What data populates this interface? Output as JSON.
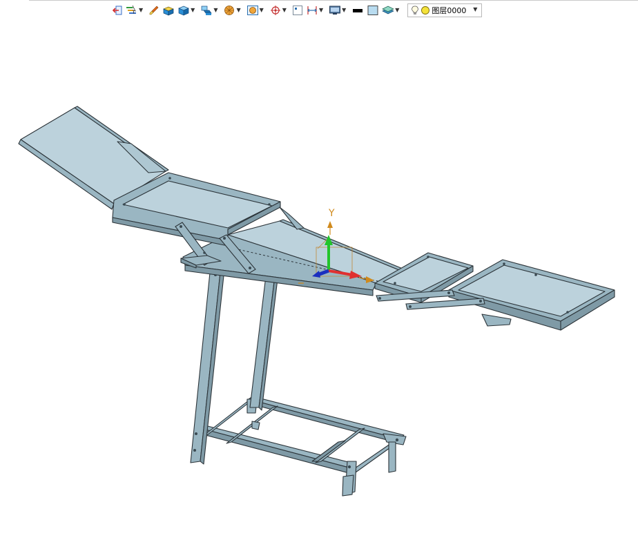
{
  "toolbar": {
    "layer_value": "图层0000",
    "items": [
      {
        "icon": "exit-sketch-icon"
      },
      {
        "icon": "selection-filter-icon",
        "dropdown": true
      },
      {
        "icon": "brush-icon"
      },
      {
        "icon": "solid-box-icon"
      },
      {
        "icon": "cube-icon",
        "dropdown": true
      },
      {
        "icon": "extrude-icon",
        "dropdown": true
      },
      {
        "icon": "sphere-render-icon",
        "dropdown": true
      },
      {
        "icon": "view-fit-icon",
        "dropdown": true
      },
      {
        "icon": "snap-target-icon",
        "dropdown": true
      },
      {
        "icon": "frame-icon"
      },
      {
        "icon": "dimension-icon",
        "dropdown": true
      },
      {
        "icon": "display-monitor-icon",
        "dropdown": true
      },
      {
        "icon": "line-color-icon"
      },
      {
        "icon": "fill-color-icon"
      },
      {
        "icon": "layer-stack-icon",
        "dropdown": true
      }
    ]
  },
  "viewport": {
    "axis_label_y": "Y",
    "background": "#ffffff",
    "model_color": "#9ab6c2",
    "edge_color": "#2b3338"
  },
  "colors": {
    "axis_x": "#e03030",
    "axis_y": "#22c52b",
    "axis_z": "#1a2fbf",
    "axis_label": "#d08a1c"
  }
}
